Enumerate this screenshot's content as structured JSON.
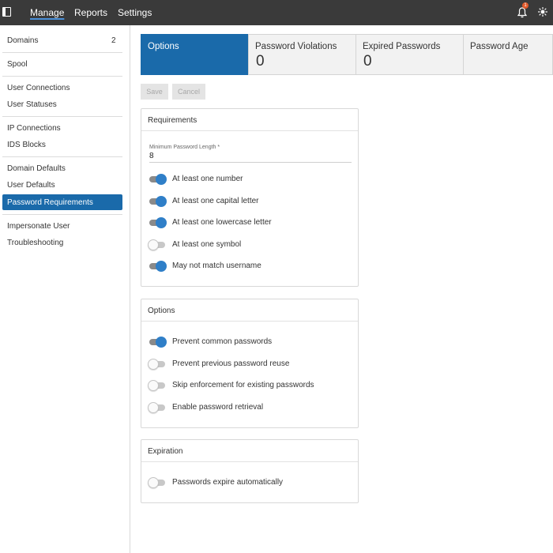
{
  "topbar": {
    "nav": [
      "Manage",
      "Reports",
      "Settings"
    ],
    "active_nav": "Manage",
    "notification_count": "1",
    "accent_color": "#4a90d9",
    "badge_color": "#e05a2b"
  },
  "sidebar": {
    "items": [
      {
        "label": "Domains",
        "count": "2"
      },
      {
        "label": "Spool"
      },
      {
        "label": "User Connections"
      },
      {
        "label": "User Statuses"
      },
      {
        "label": "IP Connections"
      },
      {
        "label": "IDS Blocks"
      },
      {
        "label": "Domain Defaults"
      },
      {
        "label": "User Defaults"
      },
      {
        "label": "Password Requirements"
      },
      {
        "label": "Impersonate User"
      },
      {
        "label": "Troubleshooting"
      }
    ],
    "active_item": "Password Requirements",
    "active_color": "#1a6aaa"
  },
  "tabs": [
    {
      "label": "Options",
      "active": true
    },
    {
      "label": "Password Violations",
      "count": "0"
    },
    {
      "label": "Expired Passwords",
      "count": "0"
    },
    {
      "label": "Password Age"
    }
  ],
  "buttons": {
    "save": "Save",
    "cancel": "Cancel"
  },
  "requirements": {
    "title": "Requirements",
    "min_length_label": "Minimum Password Length *",
    "min_length_value": "8",
    "toggles": [
      {
        "label": "At least one number",
        "on": true
      },
      {
        "label": "At least one capital letter",
        "on": true
      },
      {
        "label": "At least one lowercase letter",
        "on": true
      },
      {
        "label": "At least one symbol",
        "on": false
      },
      {
        "label": "May not match username",
        "on": true
      }
    ]
  },
  "options": {
    "title": "Options",
    "toggles": [
      {
        "label": "Prevent common passwords",
        "on": true
      },
      {
        "label": "Prevent previous password reuse",
        "on": false
      },
      {
        "label": "Skip enforcement for existing passwords",
        "on": false
      },
      {
        "label": "Enable password retrieval",
        "on": false
      }
    ]
  },
  "expiration": {
    "title": "Expiration",
    "toggles": [
      {
        "label": "Passwords expire automatically",
        "on": false
      }
    ]
  }
}
